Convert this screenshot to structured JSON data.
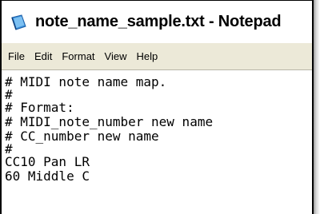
{
  "window": {
    "title": "note_name_sample.txt - Notepad"
  },
  "menubar": {
    "items": [
      "File",
      "Edit",
      "Format",
      "View",
      "Help"
    ]
  },
  "editor": {
    "lines": [
      "# MIDI note name map.",
      "#",
      "# Format:",
      "# MIDI_note_number new name",
      "# CC_number new name",
      "#",
      "CC10 Pan LR",
      "60 Middle C"
    ]
  },
  "colors": {
    "menubar_bg": "#ece9d8",
    "icon_blue": "#3a8fd9"
  },
  "icons": {
    "app": "notepad-icon"
  }
}
